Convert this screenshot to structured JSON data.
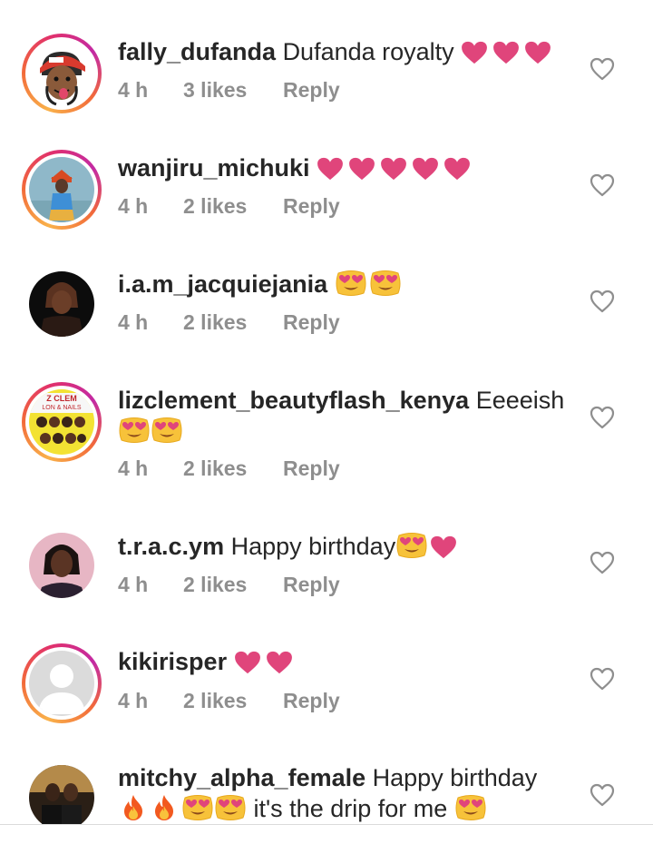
{
  "colors": {
    "text": "#262626",
    "meta": "#8e8e8e",
    "heart_emoji": "#e0457b",
    "story_ring": "#e1306c"
  },
  "icons": {
    "pink_heart": "pink-heart-emoji",
    "heart_eyes": "heart-eyes-emoji",
    "fire": "fire-emoji",
    "like_button": "heart-outline-icon"
  },
  "comments": [
    {
      "username": "fally_dufanda",
      "text": "Dufanda royalty",
      "time": "4 h",
      "likes": "3 likes",
      "reply": "Reply"
    },
    {
      "username": "wanjiru_michuki",
      "text": "",
      "time": "4 h",
      "likes": "2 likes",
      "reply": "Reply"
    },
    {
      "username": "i.a.m_jacquiejania",
      "text": "",
      "time": "4 h",
      "likes": "2 likes",
      "reply": "Reply"
    },
    {
      "username": "lizclement_beautyflash_kenya",
      "text": "Eeeeish",
      "time": "4 h",
      "likes": "2 likes",
      "reply": "Reply",
      "avatar_text_line1": "Z CLEM",
      "avatar_text_line2": "LON & NAILS"
    },
    {
      "username": "t.r.a.c.ym",
      "text": "Happy birthday",
      "time": "4 h",
      "likes": "2 likes",
      "reply": "Reply"
    },
    {
      "username": "kikirisper",
      "text": "",
      "time": "4 h",
      "likes": "2 likes",
      "reply": "Reply"
    },
    {
      "username": "mitchy_alpha_female",
      "text": "Happy birthday",
      "text2": "it's the drip for me"
    }
  ]
}
